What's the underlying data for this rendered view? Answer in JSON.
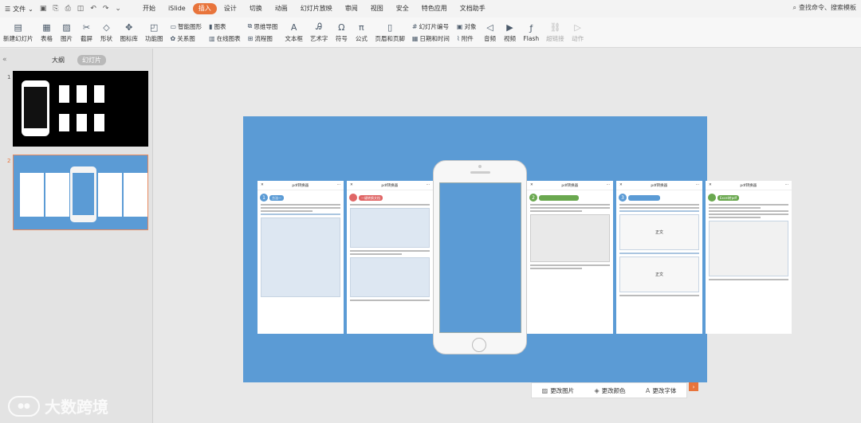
{
  "menubar": {
    "file": "文件",
    "tabs": [
      "开始",
      "iSlide",
      "插入",
      "设计",
      "切换",
      "动画",
      "幻灯片放映",
      "审阅",
      "视图",
      "安全",
      "特色应用",
      "文档助手"
    ],
    "active_tab": "插入",
    "search": "查找命令、搜索模板"
  },
  "ribbon": {
    "new_slide": "新建幻灯片",
    "table": "表格",
    "picture": "图片",
    "screenshot": "截屏",
    "shape": "形状",
    "icon_lib": "图标库",
    "func_chart": "功能图",
    "smart_graphic": "智能图形",
    "relation": "关系图",
    "chart": "图表",
    "online_chart": "在线图表",
    "mind_map": "思维导图",
    "flowchart": "流程图",
    "textbox": "文本框",
    "art_text": "艺术字",
    "symbol": "符号",
    "formula": "公式",
    "header_footer": "页眉和页脚",
    "slide_number": "幻灯片编号",
    "date_time": "日期和时间",
    "object": "对象",
    "attachment": "附件",
    "audio": "音频",
    "video": "视频",
    "flash": "Flash",
    "hyperlink": "超链接",
    "action": "动作"
  },
  "leftpanel": {
    "tab_outline": "大纲",
    "tab_slides": "幻灯片",
    "slide1_num": "1",
    "slide2_num": "2"
  },
  "cards": {
    "header_title": "pdf转换器",
    "card1_num": "1",
    "card1_label": "方法一",
    "card2_label": "一键转换文档",
    "card4_num": "2",
    "card5_num": "3",
    "card5_text_a": "正文",
    "card5_text_b": "正文",
    "card6_label": "Excel转pdf"
  },
  "bottombar": {
    "change_pic": "更改图片",
    "change_color": "更改颜色",
    "change_font": "更改字体"
  },
  "watermark": {
    "text": "大数跨境"
  },
  "colors": {
    "accent": "#e8743b",
    "slide_bg": "#5b9bd5"
  }
}
